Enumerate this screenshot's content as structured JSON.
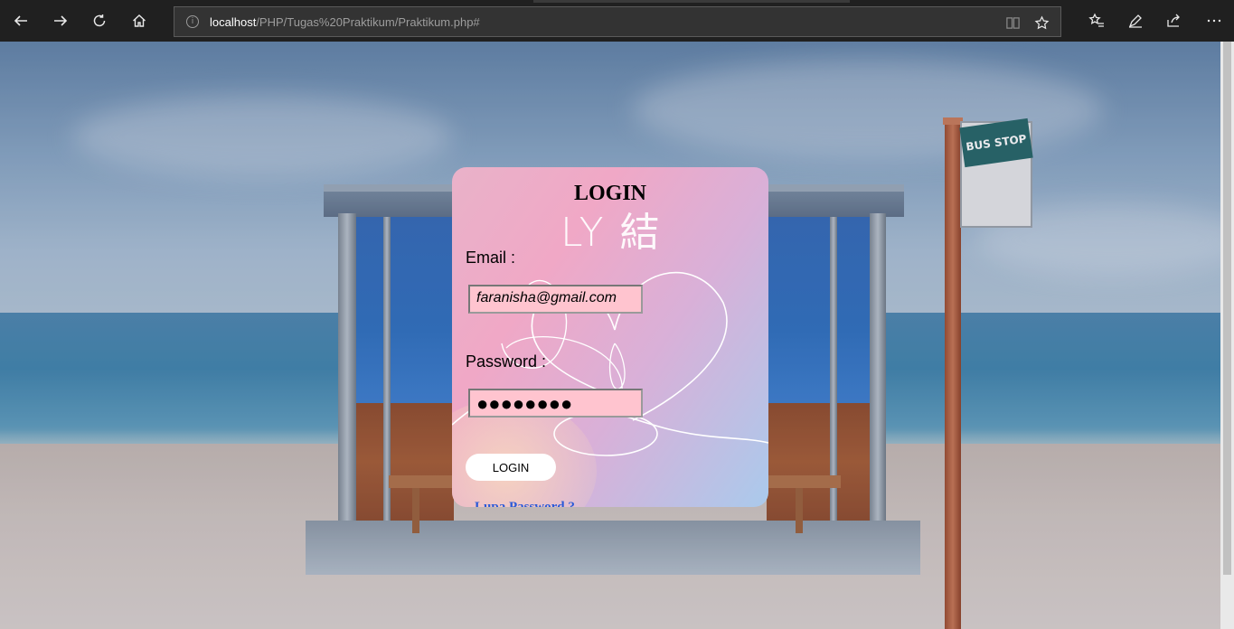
{
  "browser": {
    "url_host": "localhost",
    "url_path": "/PHP/Tugas%20Praktikum/Praktikum.php#",
    "info_symbol": "i"
  },
  "icons": {
    "back": "back-arrow-icon",
    "forward": "forward-arrow-icon",
    "refresh": "refresh-icon",
    "home": "home-icon",
    "reading_view": "reading-view-icon",
    "favorite": "star-icon",
    "favorites_hub": "favorites-list-icon",
    "notes": "pen-icon",
    "share": "share-icon",
    "more": "more-dots-icon"
  },
  "sign": {
    "header": "BUS STOP"
  },
  "login": {
    "title": "LOGIN",
    "logo_text": "LY 結",
    "email_label": "Email :",
    "email_value": "faranisha@gmail.com",
    "password_label": "Password :",
    "password_masked": "●●●●●●●●",
    "button_label": "LOGIN",
    "forgot_link": "Lupa Password ?"
  },
  "colors": {
    "chrome_bg": "#202020",
    "card_pink": "#f0a8c6",
    "card_blue": "#aacaec",
    "input_bg": "#ffc4cf",
    "link": "#2a5ad8"
  }
}
